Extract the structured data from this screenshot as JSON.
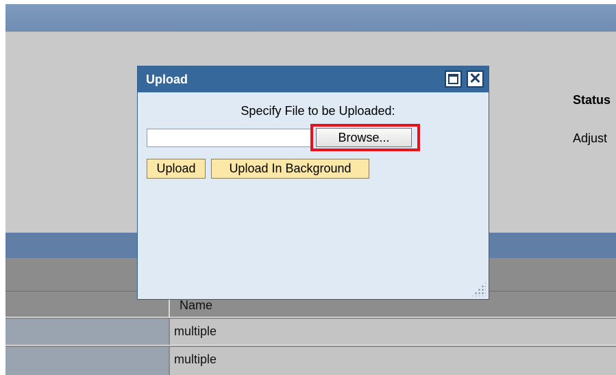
{
  "background": {
    "status_label": "Status",
    "adjust_text": "Adjust",
    "table": {
      "column_name_header": "Name",
      "rows": [
        {
          "name": "multiple"
        },
        {
          "name": "multiple"
        }
      ]
    }
  },
  "dialog": {
    "title": "Upload",
    "maximize_icon": "maximize-icon",
    "close_icon": "close-icon",
    "close_glyph": "✕",
    "specify_label": "Specify File to be Uploaded:",
    "file_input_value": "",
    "browse_label": "Browse...",
    "upload_label": "Upload",
    "upload_background_label": "Upload In Background",
    "highlight_color": "#e8121c"
  }
}
